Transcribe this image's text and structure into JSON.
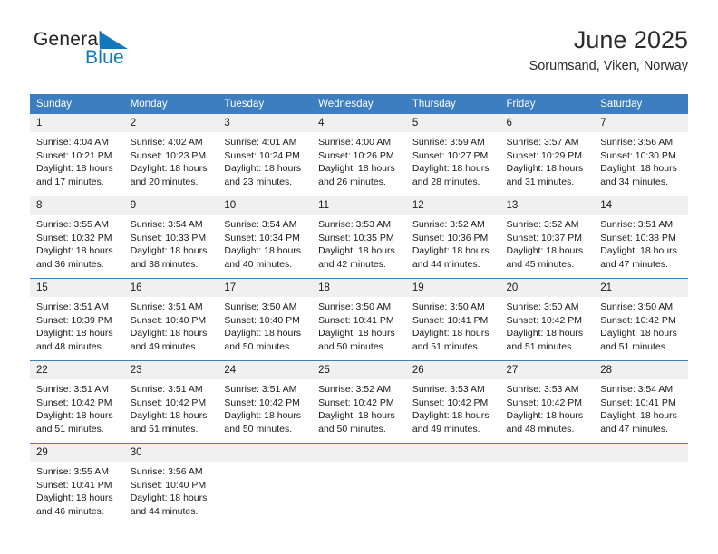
{
  "brand": {
    "name_part1": "General",
    "name_part2": "Blue",
    "mark_icon": "triangle-flag-icon",
    "accent_color": "#1278be"
  },
  "header": {
    "title": "June 2025",
    "location": "Sorumsand, Viken, Norway"
  },
  "calendar": {
    "header_bg": "#3c7ebf",
    "daynum_bg": "#f0f0f0",
    "weekday_headers": [
      "Sunday",
      "Monday",
      "Tuesday",
      "Wednesday",
      "Thursday",
      "Friday",
      "Saturday"
    ],
    "weeks": [
      [
        {
          "day": "1",
          "sunrise": "Sunrise: 4:04 AM",
          "sunset": "Sunset: 10:21 PM",
          "daylight_line1": "Daylight: 18 hours",
          "daylight_line2": "and 17 minutes."
        },
        {
          "day": "2",
          "sunrise": "Sunrise: 4:02 AM",
          "sunset": "Sunset: 10:23 PM",
          "daylight_line1": "Daylight: 18 hours",
          "daylight_line2": "and 20 minutes."
        },
        {
          "day": "3",
          "sunrise": "Sunrise: 4:01 AM",
          "sunset": "Sunset: 10:24 PM",
          "daylight_line1": "Daylight: 18 hours",
          "daylight_line2": "and 23 minutes."
        },
        {
          "day": "4",
          "sunrise": "Sunrise: 4:00 AM",
          "sunset": "Sunset: 10:26 PM",
          "daylight_line1": "Daylight: 18 hours",
          "daylight_line2": "and 26 minutes."
        },
        {
          "day": "5",
          "sunrise": "Sunrise: 3:59 AM",
          "sunset": "Sunset: 10:27 PM",
          "daylight_line1": "Daylight: 18 hours",
          "daylight_line2": "and 28 minutes."
        },
        {
          "day": "6",
          "sunrise": "Sunrise: 3:57 AM",
          "sunset": "Sunset: 10:29 PM",
          "daylight_line1": "Daylight: 18 hours",
          "daylight_line2": "and 31 minutes."
        },
        {
          "day": "7",
          "sunrise": "Sunrise: 3:56 AM",
          "sunset": "Sunset: 10:30 PM",
          "daylight_line1": "Daylight: 18 hours",
          "daylight_line2": "and 34 minutes."
        }
      ],
      [
        {
          "day": "8",
          "sunrise": "Sunrise: 3:55 AM",
          "sunset": "Sunset: 10:32 PM",
          "daylight_line1": "Daylight: 18 hours",
          "daylight_line2": "and 36 minutes."
        },
        {
          "day": "9",
          "sunrise": "Sunrise: 3:54 AM",
          "sunset": "Sunset: 10:33 PM",
          "daylight_line1": "Daylight: 18 hours",
          "daylight_line2": "and 38 minutes."
        },
        {
          "day": "10",
          "sunrise": "Sunrise: 3:54 AM",
          "sunset": "Sunset: 10:34 PM",
          "daylight_line1": "Daylight: 18 hours",
          "daylight_line2": "and 40 minutes."
        },
        {
          "day": "11",
          "sunrise": "Sunrise: 3:53 AM",
          "sunset": "Sunset: 10:35 PM",
          "daylight_line1": "Daylight: 18 hours",
          "daylight_line2": "and 42 minutes."
        },
        {
          "day": "12",
          "sunrise": "Sunrise: 3:52 AM",
          "sunset": "Sunset: 10:36 PM",
          "daylight_line1": "Daylight: 18 hours",
          "daylight_line2": "and 44 minutes."
        },
        {
          "day": "13",
          "sunrise": "Sunrise: 3:52 AM",
          "sunset": "Sunset: 10:37 PM",
          "daylight_line1": "Daylight: 18 hours",
          "daylight_line2": "and 45 minutes."
        },
        {
          "day": "14",
          "sunrise": "Sunrise: 3:51 AM",
          "sunset": "Sunset: 10:38 PM",
          "daylight_line1": "Daylight: 18 hours",
          "daylight_line2": "and 47 minutes."
        }
      ],
      [
        {
          "day": "15",
          "sunrise": "Sunrise: 3:51 AM",
          "sunset": "Sunset: 10:39 PM",
          "daylight_line1": "Daylight: 18 hours",
          "daylight_line2": "and 48 minutes."
        },
        {
          "day": "16",
          "sunrise": "Sunrise: 3:51 AM",
          "sunset": "Sunset: 10:40 PM",
          "daylight_line1": "Daylight: 18 hours",
          "daylight_line2": "and 49 minutes."
        },
        {
          "day": "17",
          "sunrise": "Sunrise: 3:50 AM",
          "sunset": "Sunset: 10:40 PM",
          "daylight_line1": "Daylight: 18 hours",
          "daylight_line2": "and 50 minutes."
        },
        {
          "day": "18",
          "sunrise": "Sunrise: 3:50 AM",
          "sunset": "Sunset: 10:41 PM",
          "daylight_line1": "Daylight: 18 hours",
          "daylight_line2": "and 50 minutes."
        },
        {
          "day": "19",
          "sunrise": "Sunrise: 3:50 AM",
          "sunset": "Sunset: 10:41 PM",
          "daylight_line1": "Daylight: 18 hours",
          "daylight_line2": "and 51 minutes."
        },
        {
          "day": "20",
          "sunrise": "Sunrise: 3:50 AM",
          "sunset": "Sunset: 10:42 PM",
          "daylight_line1": "Daylight: 18 hours",
          "daylight_line2": "and 51 minutes."
        },
        {
          "day": "21",
          "sunrise": "Sunrise: 3:50 AM",
          "sunset": "Sunset: 10:42 PM",
          "daylight_line1": "Daylight: 18 hours",
          "daylight_line2": "and 51 minutes."
        }
      ],
      [
        {
          "day": "22",
          "sunrise": "Sunrise: 3:51 AM",
          "sunset": "Sunset: 10:42 PM",
          "daylight_line1": "Daylight: 18 hours",
          "daylight_line2": "and 51 minutes."
        },
        {
          "day": "23",
          "sunrise": "Sunrise: 3:51 AM",
          "sunset": "Sunset: 10:42 PM",
          "daylight_line1": "Daylight: 18 hours",
          "daylight_line2": "and 51 minutes."
        },
        {
          "day": "24",
          "sunrise": "Sunrise: 3:51 AM",
          "sunset": "Sunset: 10:42 PM",
          "daylight_line1": "Daylight: 18 hours",
          "daylight_line2": "and 50 minutes."
        },
        {
          "day": "25",
          "sunrise": "Sunrise: 3:52 AM",
          "sunset": "Sunset: 10:42 PM",
          "daylight_line1": "Daylight: 18 hours",
          "daylight_line2": "and 50 minutes."
        },
        {
          "day": "26",
          "sunrise": "Sunrise: 3:53 AM",
          "sunset": "Sunset: 10:42 PM",
          "daylight_line1": "Daylight: 18 hours",
          "daylight_line2": "and 49 minutes."
        },
        {
          "day": "27",
          "sunrise": "Sunrise: 3:53 AM",
          "sunset": "Sunset: 10:42 PM",
          "daylight_line1": "Daylight: 18 hours",
          "daylight_line2": "and 48 minutes."
        },
        {
          "day": "28",
          "sunrise": "Sunrise: 3:54 AM",
          "sunset": "Sunset: 10:41 PM",
          "daylight_line1": "Daylight: 18 hours",
          "daylight_line2": "and 47 minutes."
        }
      ],
      [
        {
          "day": "29",
          "sunrise": "Sunrise: 3:55 AM",
          "sunset": "Sunset: 10:41 PM",
          "daylight_line1": "Daylight: 18 hours",
          "daylight_line2": "and 46 minutes."
        },
        {
          "day": "30",
          "sunrise": "Sunrise: 3:56 AM",
          "sunset": "Sunset: 10:40 PM",
          "daylight_line1": "Daylight: 18 hours",
          "daylight_line2": "and 44 minutes."
        },
        {
          "day": "",
          "sunrise": "",
          "sunset": "",
          "daylight_line1": "",
          "daylight_line2": ""
        },
        {
          "day": "",
          "sunrise": "",
          "sunset": "",
          "daylight_line1": "",
          "daylight_line2": ""
        },
        {
          "day": "",
          "sunrise": "",
          "sunset": "",
          "daylight_line1": "",
          "daylight_line2": ""
        },
        {
          "day": "",
          "sunrise": "",
          "sunset": "",
          "daylight_line1": "",
          "daylight_line2": ""
        },
        {
          "day": "",
          "sunrise": "",
          "sunset": "",
          "daylight_line1": "",
          "daylight_line2": ""
        }
      ]
    ]
  }
}
